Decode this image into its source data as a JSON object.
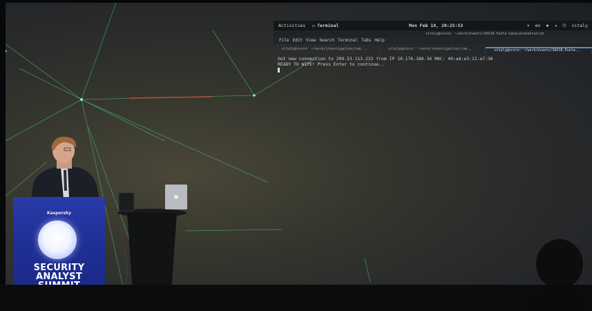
{
  "terminal": {
    "topbar": {
      "activities": "Activities",
      "app_name": "Terminal",
      "clock": "Mon Feb 18, 20:25:53",
      "lang": "en",
      "user": "vitaly"
    },
    "window_title": "vitaly@vcore: ~/work/events/SAS18.Punta-Cana/presentation",
    "menu": [
      "File",
      "Edit",
      "View",
      "Search",
      "Terminal",
      "Tabs",
      "Help"
    ],
    "tabs": [
      {
        "label": "vitaly@vcore: ~/work/investigation/com...",
        "active": false
      },
      {
        "label": "vitaly@vcore: ~/work/investigation/com...",
        "active": false
      },
      {
        "label": "vitaly@vcore: ~/work/events/SAS18.Punta...",
        "active": true
      }
    ],
    "lines": [
      "Got new connection to 209.53.113.223 from IP 10.176.186.34 MAC: 49:ad:e3:12:a7:36",
      "READY TO WIPE! Press Enter to continue.."
    ]
  },
  "podium": {
    "brand": "Kaspersky",
    "title_lines": [
      "SECURITY",
      "ANALYST",
      "SUMMIT"
    ]
  },
  "colors": {
    "laser_green": "#4bd98a",
    "laser_red": "#e0432e",
    "podium_blue": "#2236a0"
  }
}
